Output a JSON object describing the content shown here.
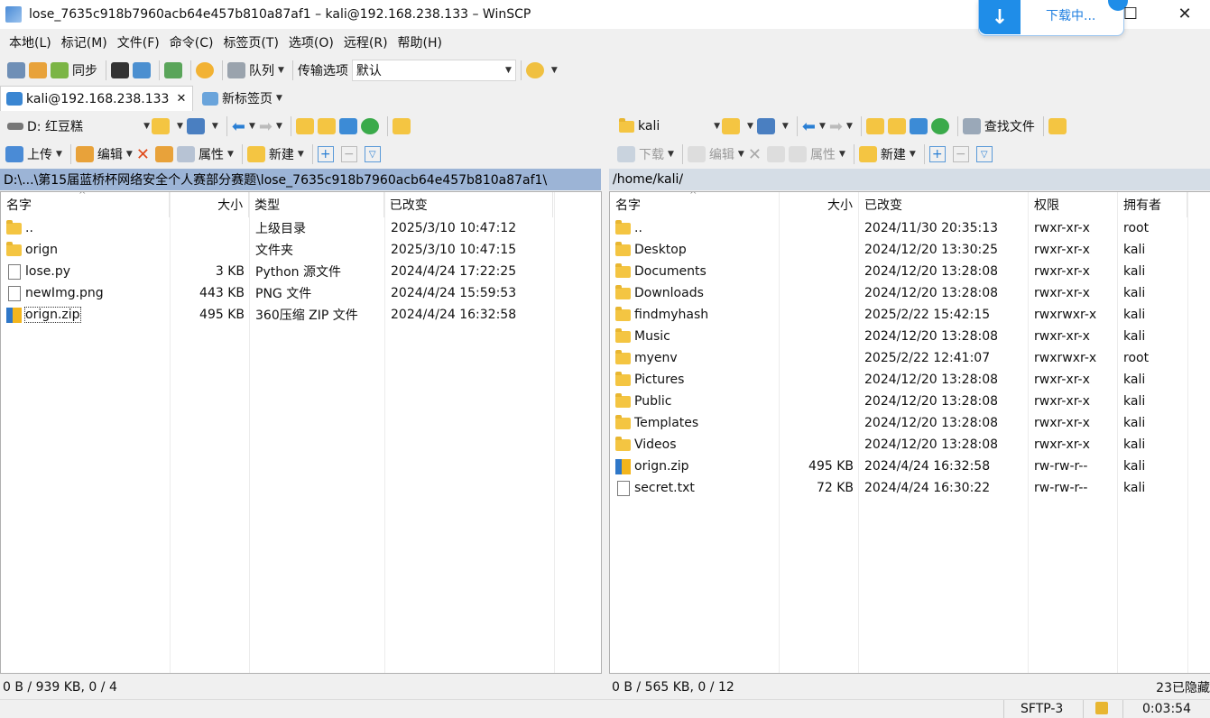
{
  "window": {
    "title": "lose_7635c918b7960acb64e457b810a87af1 – kali@192.168.238.133 – WinSCP",
    "min": "—",
    "max": "☐",
    "close": "✕"
  },
  "download_popup": {
    "label": "下载中..."
  },
  "menu": [
    "本地(L)",
    "标记(M)",
    "文件(F)",
    "命令(C)",
    "标签页(T)",
    "选项(O)",
    "远程(R)",
    "帮助(H)"
  ],
  "toolbar": {
    "sync": "同步",
    "queue": "队列",
    "transfer_label": "传输选项",
    "transfer_value": "默认"
  },
  "tabs": [
    {
      "label": "kali@192.168.238.133"
    },
    {
      "label": "新标签页"
    }
  ],
  "left": {
    "drive": "D: 红豆糕",
    "upload": "上传",
    "edit": "编辑",
    "properties": "属性",
    "new": "新建",
    "path": "D:\\...\\第15届蓝桥杯网络安全个人赛部分赛题\\lose_7635c918b7960acb64e457b810a87af1\\",
    "headers": [
      "名字",
      "大小",
      "类型",
      "已改变"
    ],
    "rows": [
      {
        "name": "..",
        "size": "",
        "type": "上级目录",
        "changed": "2025/3/10 10:47:12",
        "icon": "up-folder"
      },
      {
        "name": "orign",
        "size": "",
        "type": "文件夹",
        "changed": "2025/3/10 10:47:15",
        "icon": "folder"
      },
      {
        "name": "lose.py",
        "size": "3 KB",
        "type": "Python 源文件",
        "changed": "2024/4/24 17:22:25",
        "icon": "file"
      },
      {
        "name": "newImg.png",
        "size": "443 KB",
        "type": "PNG 文件",
        "changed": "2024/4/24 15:59:53",
        "icon": "file"
      },
      {
        "name": "orign.zip",
        "size": "495 KB",
        "type": "360压缩 ZIP 文件",
        "changed": "2024/4/24 16:32:58",
        "icon": "zip"
      }
    ],
    "status": "0 B / 939 KB,  0 / 4"
  },
  "right": {
    "drive": "kali",
    "download": "下载",
    "edit": "编辑",
    "properties": "属性",
    "new": "新建",
    "find": "查找文件",
    "path": "/home/kali/",
    "headers": [
      "名字",
      "大小",
      "已改变",
      "权限",
      "拥有者"
    ],
    "rows": [
      {
        "name": "..",
        "size": "",
        "changed": "2024/11/30 20:35:13",
        "perm": "rwxr-xr-x",
        "owner": "root",
        "icon": "up-folder"
      },
      {
        "name": "Desktop",
        "size": "",
        "changed": "2024/12/20 13:30:25",
        "perm": "rwxr-xr-x",
        "owner": "kali",
        "icon": "folder"
      },
      {
        "name": "Documents",
        "size": "",
        "changed": "2024/12/20 13:28:08",
        "perm": "rwxr-xr-x",
        "owner": "kali",
        "icon": "folder"
      },
      {
        "name": "Downloads",
        "size": "",
        "changed": "2024/12/20 13:28:08",
        "perm": "rwxr-xr-x",
        "owner": "kali",
        "icon": "folder"
      },
      {
        "name": "findmyhash",
        "size": "",
        "changed": "2025/2/22 15:42:15",
        "perm": "rwxrwxr-x",
        "owner": "kali",
        "icon": "folder"
      },
      {
        "name": "Music",
        "size": "",
        "changed": "2024/12/20 13:28:08",
        "perm": "rwxr-xr-x",
        "owner": "kali",
        "icon": "folder"
      },
      {
        "name": "myenv",
        "size": "",
        "changed": "2025/2/22 12:41:07",
        "perm": "rwxrwxr-x",
        "owner": "root",
        "icon": "folder"
      },
      {
        "name": "Pictures",
        "size": "",
        "changed": "2024/12/20 13:28:08",
        "perm": "rwxr-xr-x",
        "owner": "kali",
        "icon": "folder"
      },
      {
        "name": "Public",
        "size": "",
        "changed": "2024/12/20 13:28:08",
        "perm": "rwxr-xr-x",
        "owner": "kali",
        "icon": "folder"
      },
      {
        "name": "Templates",
        "size": "",
        "changed": "2024/12/20 13:28:08",
        "perm": "rwxr-xr-x",
        "owner": "kali",
        "icon": "folder"
      },
      {
        "name": "Videos",
        "size": "",
        "changed": "2024/12/20 13:28:08",
        "perm": "rwxr-xr-x",
        "owner": "kali",
        "icon": "folder"
      },
      {
        "name": "orign.zip",
        "size": "495 KB",
        "changed": "2024/4/24 16:32:58",
        "perm": "rw-rw-r--",
        "owner": "kali",
        "icon": "zip"
      },
      {
        "name": "secret.txt",
        "size": "72 KB",
        "changed": "2024/4/24 16:30:22",
        "perm": "rw-rw-r--",
        "owner": "kali",
        "icon": "file"
      }
    ],
    "status": "0 B / 565 KB,  0 / 12",
    "hidden": "23已隐藏"
  },
  "bottom": {
    "protocol": "SFTP-3",
    "time": "0:03:54"
  }
}
